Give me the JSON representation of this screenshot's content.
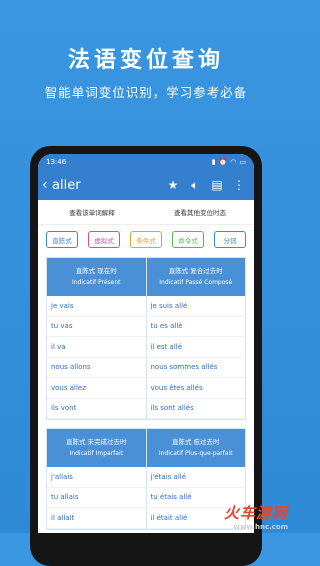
{
  "hero": {
    "title": "法语变位查询",
    "subtitle": "智能单词变位识别，学习参考必备"
  },
  "status": {
    "time": "13:46",
    "icons": [
      "sim-icon",
      "alarm-icon",
      "wifi-icon",
      "battery-icon"
    ]
  },
  "appbar": {
    "back_icon": "chevron-left-icon",
    "word": "aller",
    "icons": [
      "star-icon",
      "speaker-icon",
      "notebook-icon",
      "more-icon"
    ]
  },
  "links": {
    "left": "查看该单词解释",
    "right": "查看其他变位时态"
  },
  "chips": [
    {
      "label": "直陈式",
      "color": "#3f86d3"
    },
    {
      "label": "虚拟式",
      "color": "#d24da8"
    },
    {
      "label": "条件式",
      "color": "#e4a12a"
    },
    {
      "label": "命令式",
      "color": "#5bb552"
    },
    {
      "label": "分词",
      "color": "#3f86d3"
    }
  ],
  "blocks": [
    {
      "left": {
        "title_cn": "直陈式 现在时",
        "title_fr": "Indicatif Présent",
        "rows": [
          "je vais",
          "tu vas",
          "il va",
          "nous allons",
          "vous allez",
          "ils vont"
        ]
      },
      "right": {
        "title_cn": "直陈式 复合过去时",
        "title_fr": "Indicatif Passé Composé",
        "rows": [
          "je suis allé",
          "tu es allé",
          "il est allé",
          "nous sommes allés",
          "vous êtes allés",
          "ils sont allés"
        ]
      }
    },
    {
      "left": {
        "title_cn": "直陈式 未完成过去时",
        "title_fr": "Indicatif Imparfait",
        "rows": [
          "j'allais",
          "tu allais",
          "il allait"
        ]
      },
      "right": {
        "title_cn": "直陈式 愈过去时",
        "title_fr": "Indicatif Plus-que-parfait",
        "rows": [
          "j'étais allé",
          "tu étais allé",
          "il était allé"
        ]
      }
    }
  ],
  "watermark": {
    "brand": "火车游网",
    "url": "www.hnc.com"
  }
}
